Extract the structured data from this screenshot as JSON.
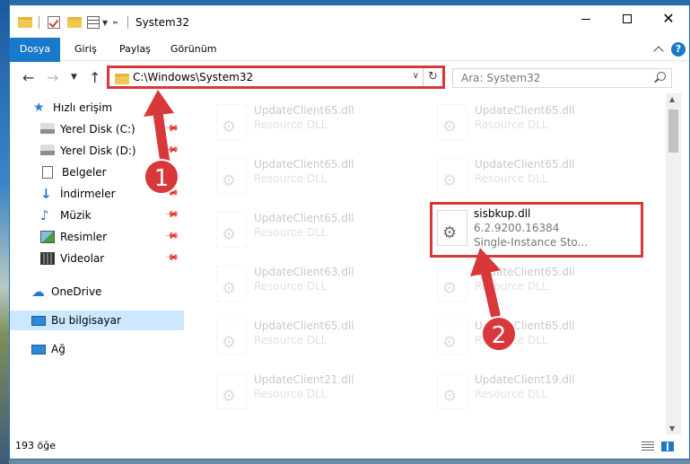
{
  "window": {
    "title": "System32"
  },
  "ribbon": {
    "tabs": [
      {
        "label": "Dosya"
      },
      {
        "label": "Giriş"
      },
      {
        "label": "Paylaş"
      },
      {
        "label": "Görünüm"
      }
    ],
    "help": "?"
  },
  "address": {
    "path": "C:\\Windows\\System32",
    "search_placeholder": "Ara: System32"
  },
  "nav": {
    "items": [
      {
        "label": "Hızlı erişim",
        "icon": "star-icon"
      },
      {
        "label": "Yerel Disk (C:)",
        "icon": "drive-icon",
        "pinned": true
      },
      {
        "label": "Yerel Disk (D:)",
        "icon": "drive-icon",
        "pinned": true
      },
      {
        "label": "Belgeler",
        "icon": "document-icon",
        "pinned": true
      },
      {
        "label": "İndirmeler",
        "icon": "download-icon",
        "pinned": true
      },
      {
        "label": "Müzik",
        "icon": "music-icon",
        "pinned": true
      },
      {
        "label": "Resimler",
        "icon": "pictures-icon",
        "pinned": true
      },
      {
        "label": "Videolar",
        "icon": "video-icon",
        "pinned": true
      },
      {
        "label": "OneDrive",
        "icon": "cloud-icon"
      },
      {
        "label": "Bu bilgisayar",
        "icon": "computer-icon",
        "selected": true
      },
      {
        "label": "Ağ",
        "icon": "network-icon"
      }
    ]
  },
  "files": [
    {
      "name": "UpdateClient65.dll",
      "meta1": "Resource DLL",
      "meta2": ""
    },
    {
      "name": "UpdateClient65.dll",
      "meta1": "Resource DLL",
      "meta2": ""
    },
    {
      "name": "UpdateClient65.dll",
      "meta1": "Resource DLL",
      "meta2": ""
    },
    {
      "name": "UpdateClient65.dll",
      "meta1": "Resource DLL",
      "meta2": ""
    },
    {
      "name": "UpdateClient65.dll",
      "meta1": "Resource DLL",
      "meta2": ""
    },
    {
      "name": "sisbkup.dll",
      "meta1": "6.2.9200.16384",
      "meta2": "Single-Instance Sto..."
    },
    {
      "name": "UpdateClient63.dll",
      "meta1": "Resource DLL",
      "meta2": ""
    },
    {
      "name": "UpdateClient65.dll",
      "meta1": "Resource DLL",
      "meta2": ""
    },
    {
      "name": "UpdateClient65.dll",
      "meta1": "Resource DLL",
      "meta2": ""
    },
    {
      "name": "UpdateClient65.dll",
      "meta1": "Resource DLL",
      "meta2": ""
    },
    {
      "name": "UpdateClient21.dll",
      "meta1": "Resource DLL",
      "meta2": ""
    },
    {
      "name": "UpdateClient19.dll",
      "meta1": "Resource DLL",
      "meta2": ""
    }
  ],
  "status": {
    "count": "193 öğe"
  },
  "annotations": {
    "step1": "1",
    "step2": "2",
    "color": "#d9383a"
  }
}
